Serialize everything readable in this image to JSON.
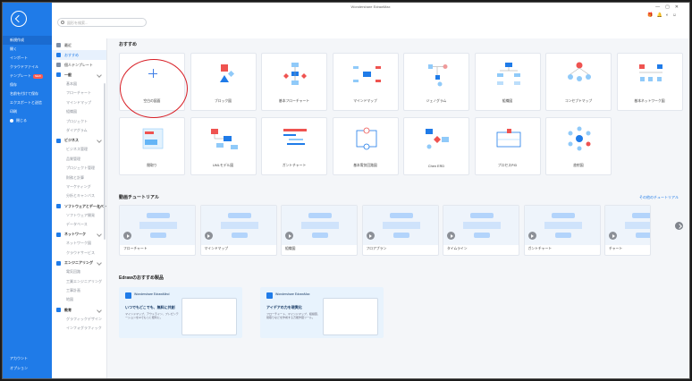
{
  "window": {
    "title": "Wondershare EdrawMax",
    "controls": [
      "—",
      "▢",
      "✕"
    ]
  },
  "nav": {
    "items": [
      {
        "label": "新規作成",
        "active": true
      },
      {
        "label": "開く"
      },
      {
        "label": "インポート"
      },
      {
        "label": "クラウドファイル"
      },
      {
        "label": "テンプレート",
        "badge": "NEW"
      },
      {
        "label": "保存"
      },
      {
        "label": "名前を付けて保存"
      },
      {
        "label": "エクスポートと送信"
      },
      {
        "label": "印刷"
      },
      {
        "label": "閉じる"
      }
    ],
    "bottom": [
      "アカウント",
      "オプション"
    ]
  },
  "search": {
    "placeholder": "図形を検索..."
  },
  "categories": [
    {
      "label": "最近",
      "type": "top",
      "color": "#7f8fa6"
    },
    {
      "label": "おすすめ",
      "type": "top",
      "active": true,
      "color": "#1f7be8"
    },
    {
      "label": "個人テンプレート",
      "type": "top",
      "color": "#7f8fa6"
    },
    {
      "label": "一般",
      "type": "head",
      "color": "#1f7be8"
    },
    {
      "label": "基本図",
      "type": "sub"
    },
    {
      "label": "フローチャート",
      "type": "sub"
    },
    {
      "label": "マインドマップ",
      "type": "sub"
    },
    {
      "label": "組織図",
      "type": "sub"
    },
    {
      "label": "プロジェクト",
      "type": "sub"
    },
    {
      "label": "ダイアグラム",
      "type": "sub"
    },
    {
      "label": "ビジネス",
      "type": "head",
      "color": "#1f7be8"
    },
    {
      "label": "ビジネス管理",
      "type": "sub"
    },
    {
      "label": "品質管理",
      "type": "sub"
    },
    {
      "label": "プロジェクト管理",
      "type": "sub"
    },
    {
      "label": "財務と計算",
      "type": "sub"
    },
    {
      "label": "マーケティング",
      "type": "sub"
    },
    {
      "label": "分析とキャンバス",
      "type": "sub"
    },
    {
      "label": "ソフトウェアとデータベース",
      "type": "head",
      "color": "#1f7be8"
    },
    {
      "label": "ソフトウェア開発",
      "type": "sub"
    },
    {
      "label": "データベース",
      "type": "sub"
    },
    {
      "label": "ネットワーク",
      "type": "head",
      "color": "#1f7be8"
    },
    {
      "label": "ネットワーク図",
      "type": "sub"
    },
    {
      "label": "クラウドサービス",
      "type": "sub"
    },
    {
      "label": "エンジニアリング",
      "type": "head",
      "color": "#1f7be8"
    },
    {
      "label": "電気回路",
      "type": "sub"
    },
    {
      "label": "工業エンジニアリング",
      "type": "sub"
    },
    {
      "label": "工事計画",
      "type": "sub"
    },
    {
      "label": "地図",
      "type": "sub"
    },
    {
      "label": "教育",
      "type": "head",
      "color": "#1f7be8"
    },
    {
      "label": "グラフィックデザイン",
      "type": "sub"
    },
    {
      "label": "インフォグラフィック",
      "type": "sub"
    }
  ],
  "sections": {
    "recommended": "おすすめ",
    "tutorials": "動画チュートリアル",
    "tutorials_more": "その他のチュートリアル",
    "products": "Edrawのおすすめ製品"
  },
  "templates": [
    {
      "label": "空白の図面",
      "icon": "plus-icon"
    },
    {
      "label": "ブロック図",
      "icon": "block-diagram-icon"
    },
    {
      "label": "基本フローチャート",
      "icon": "flowchart-icon"
    },
    {
      "label": "マインドマップ",
      "icon": "mindmap-icon"
    },
    {
      "label": "ジェノグラム",
      "icon": "genogram-icon"
    },
    {
      "label": "組織図",
      "icon": "org-chart-icon"
    },
    {
      "label": "コンセプトマップ",
      "icon": "concept-map-icon"
    },
    {
      "label": "基本ネットワーク図",
      "icon": "network-icon"
    },
    {
      "label": "間取り",
      "icon": "floorplan-icon"
    },
    {
      "label": "UMLモデル図",
      "icon": "uml-icon"
    },
    {
      "label": "ガントチャート",
      "icon": "gantt-icon"
    },
    {
      "label": "基本電気回路図",
      "icon": "circuit-icon"
    },
    {
      "label": "Chen ERD",
      "icon": "erd-icon"
    },
    {
      "label": "プロセスPID",
      "icon": "pid-icon"
    },
    {
      "label": "放射図",
      "icon": "radial-icon"
    }
  ],
  "tutorials": [
    {
      "label": "フローチャート"
    },
    {
      "label": "マインドマップ"
    },
    {
      "label": "組織図"
    },
    {
      "label": "フロアプラン"
    },
    {
      "label": "タイムライン"
    },
    {
      "label": "ガントチャート"
    },
    {
      "label": "チャート"
    }
  ],
  "products": [
    {
      "brand": "Wondershare EdrawMind",
      "headline": "いつでもどこでも、無料に共創",
      "desc": "マインドマップ、アウトライン、プレゼンテーションをAIでもっと便利に。"
    },
    {
      "brand": "Wondershare EdrawMax",
      "headline": "アイデアの力を現実化",
      "desc": "フローチャート、マインドマップ、組織図、間取りなどを作成する万能作図ツール。"
    }
  ]
}
